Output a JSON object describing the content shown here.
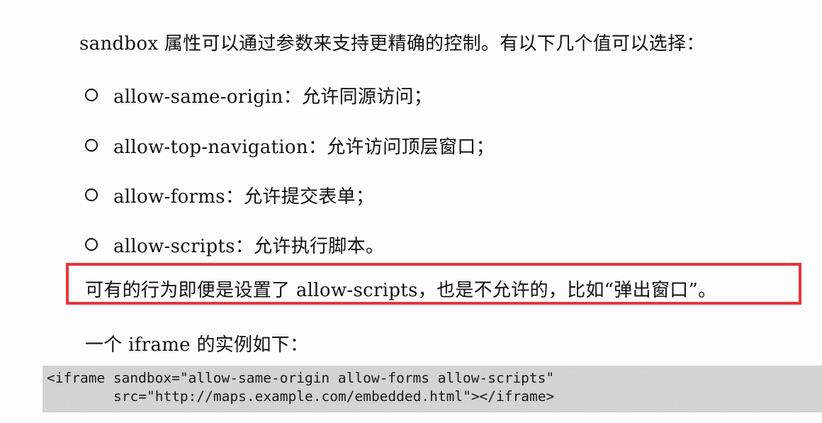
{
  "intro": "sandbox 属性可以通过参数来支持更精确的控制。有以下几个值可以选择：",
  "options": [
    "allow-same-origin：允许同源访问；",
    "allow-top-navigation：允许访问顶层窗口；",
    "allow-forms：允许提交表单；",
    "allow-scripts：允许执行脚本。"
  ],
  "note": "可有的行为即便是设置了 allow-scripts，也是不允许的，比如“弹出窗口”。",
  "example_intro": "一个 iframe 的实例如下：",
  "code": [
    "<iframe sandbox=\"allow-same-origin allow-forms allow-scripts\"",
    "src=\"http://maps.example.com/embedded.html\"></iframe>"
  ],
  "colors": {
    "highlight_border": "#e8343c",
    "code_background": "#e2e2e2",
    "text": "#111111"
  }
}
